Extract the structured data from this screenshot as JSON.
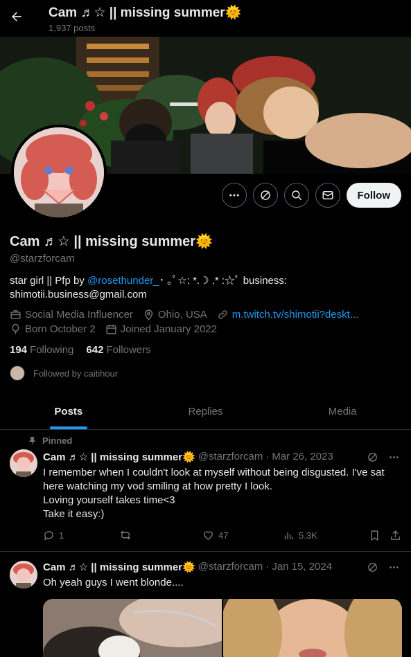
{
  "header": {
    "title": "Cam ♬☆ || missing summer🌞",
    "posts_count": "1,937 posts"
  },
  "profile": {
    "display_name": "Cam ♬☆ || missing summer🌞",
    "handle": "@starzforcam",
    "bio_prefix": "star girl || Pfp by ",
    "bio_mention": "@rosethunder_",
    "bio_suffix": "･ ｡ﾟ☆: *.☽ .* :☆ﾟ business:",
    "bio_line2": "shimotii.business@gmail.com",
    "category": "Social Media Influencer",
    "location": "Ohio, USA",
    "website": "m.twitch.tv/shimotii?deskt...",
    "birthday": "Born October 2",
    "joined": "Joined January 2022",
    "following_count": "194",
    "following_label": "Following",
    "followers_count": "642",
    "followers_label": "Followers",
    "followed_by": "Followed by caitihour"
  },
  "actions": {
    "follow_label": "Follow"
  },
  "tabs": [
    {
      "label": "Posts"
    },
    {
      "label": "Replies"
    },
    {
      "label": "Media"
    }
  ],
  "tweets": [
    {
      "pinned_label": "Pinned",
      "name": "Cam ♬☆ || missing summer🌞",
      "handle": "@starzforcam",
      "date": "Mar 26, 2023",
      "body": "I remember when I couldn't look at myself without being disgusted. I've sat here watching my vod smiling at how pretty I look.\nLoving yourself takes time<3\nTake it easy:)",
      "replies": "1",
      "likes": "47",
      "views": "5.3K"
    },
    {
      "name": "Cam ♬☆ || missing summer🌞",
      "handle": "@starzforcam",
      "date": "Jan 15, 2024",
      "body": "Oh yeah guys I went blonde...."
    }
  ],
  "colors": {
    "accent": "#1d9bf0",
    "background": "#000000",
    "muted": "#71767b",
    "text": "#e7e9ea"
  }
}
